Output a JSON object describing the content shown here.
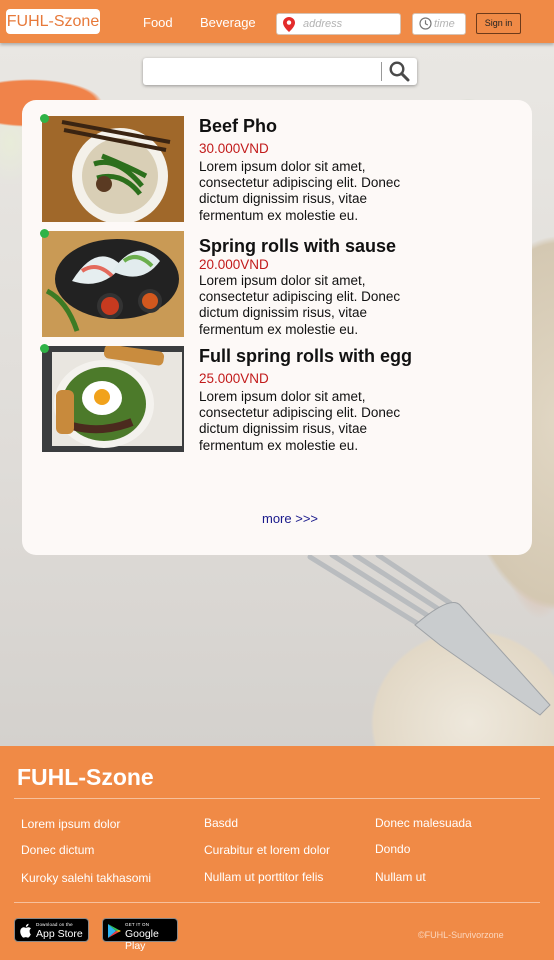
{
  "header": {
    "logo": "FUHL-Szone",
    "nav": [
      "Food",
      "Beverage"
    ],
    "address_placeholder": "address",
    "time_placeholder": "time",
    "signin_label": "Sign in"
  },
  "search": {
    "placeholder": ""
  },
  "menu": {
    "items": [
      {
        "name": "Beef Pho",
        "price": "30.000VND",
        "description": "Lorem ipsum dolor sit amet, consectetur adipiscing elit. Donec dictum dignissim risus, vitae fermentum ex molestie eu.",
        "available": true
      },
      {
        "name": "Spring rolls with sause",
        "price": "20.000VND",
        "description": "Lorem ipsum dolor sit amet, consectetur adipiscing elit. Donec dictum dignissim risus, vitae fermentum ex molestie eu.",
        "available": true
      },
      {
        "name": "Full spring rolls with egg",
        "price": "25.000VND",
        "description": "Lorem ipsum dolor sit amet, consectetur adipiscing elit. Donec dictum dignissim risus, vitae fermentum ex molestie eu.",
        "available": true
      }
    ],
    "more_label": "more >>>"
  },
  "footer": {
    "logo": "FUHL-Szone",
    "columns": [
      [
        "Lorem ipsum dolor",
        "Donec dictum",
        "Kuroky salehi takhasomi"
      ],
      [
        "Basdd",
        "Curabitur et lorem dolor",
        "Nullam ut porttitor felis"
      ],
      [
        "Donec malesuada",
        "Dondo",
        "Nullam ut"
      ]
    ],
    "app_store": {
      "small": "Download on the",
      "big": "App Store"
    },
    "google_play": {
      "small": "GET IT ON",
      "big": "Google Play"
    },
    "copyright": "©FUHL-Survivorzone"
  },
  "colors": {
    "brand": "#f08a46",
    "price": "#c21b1b",
    "available_dot": "#2fb347",
    "link": "#1a1a8c"
  },
  "icons": [
    "map-pin-icon",
    "clock-icon",
    "search-icon",
    "apple-icon",
    "google-play-icon"
  ]
}
